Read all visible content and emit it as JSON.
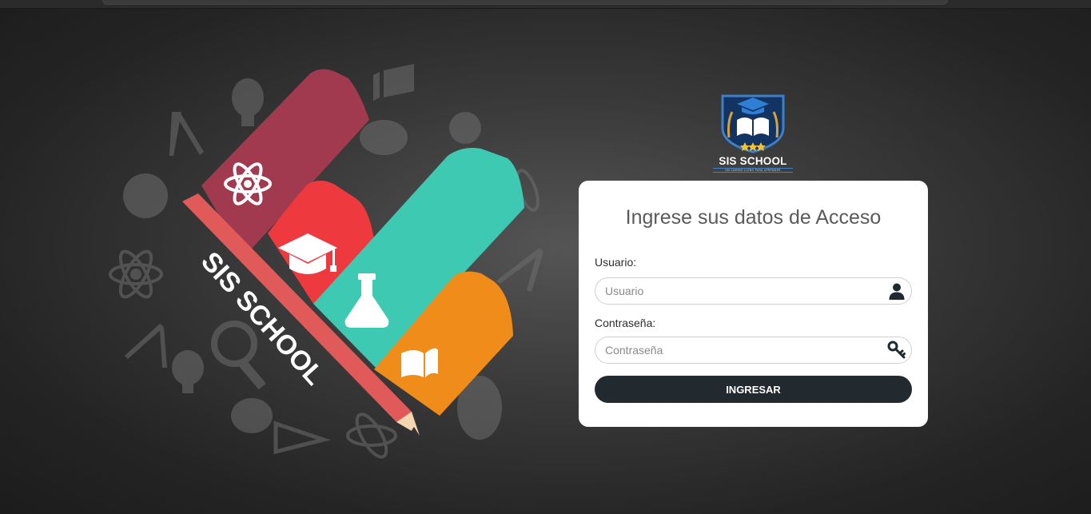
{
  "illustration": {
    "brand_text": "SIS SCHOOL",
    "colors": {
      "maroon": "#a13a4f",
      "red": "#ee3a3e",
      "teal": "#3ec9b3",
      "orange": "#f08c1a",
      "pencil": "#e05a5a"
    }
  },
  "logo": {
    "title": "SIS SCHOOL",
    "tagline": "UN CAMINO LLENO PARA APRENDER"
  },
  "login": {
    "title": "Ingrese sus datos de Acceso",
    "username_label": "Usuario:",
    "username_placeholder": "Usuario",
    "username_value": "",
    "username_icon": "user-icon",
    "password_label": "Contraseña:",
    "password_placeholder": "Contraseña",
    "password_value": "",
    "password_icon": "key-icon",
    "submit_label": "INGRESAR"
  },
  "theme": {
    "button_color": "#222a30",
    "card_color": "#ffffff"
  }
}
